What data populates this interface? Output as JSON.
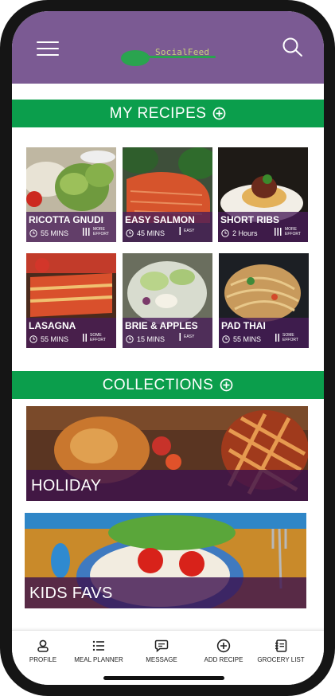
{
  "app": {
    "logo_text": "SocialFeed"
  },
  "sections": {
    "recipes_title": "MY RECIPES",
    "collections_title": "COLLECTIONS"
  },
  "recipes": [
    {
      "title": "RICOTTA GNUDI",
      "time": "55 MINS",
      "effort": "MORE EFFORT"
    },
    {
      "title": "EASY SALMON",
      "time": "45 MINS",
      "effort": "EASY"
    },
    {
      "title": "SHORT RIBS",
      "time": "2 Hours",
      "effort": "MORE EFFORT"
    },
    {
      "title": "LASAGNA",
      "time": "55 MINS",
      "effort": "SOME EFFORT"
    },
    {
      "title": "BRIE & APPLES",
      "time": "15 MINS",
      "effort": "EASY"
    },
    {
      "title": "PAD THAI",
      "time": "55 MINS",
      "effort": "SOME EFFORT"
    }
  ],
  "collections": [
    {
      "label": "HOLIDAY"
    },
    {
      "label": "KIDS FAVS"
    }
  ],
  "nav": [
    {
      "label": "PROFILE",
      "icon": "profile-icon"
    },
    {
      "label": "MEAL PLANNER",
      "icon": "list-icon"
    },
    {
      "label": "MESSAGE",
      "icon": "message-icon"
    },
    {
      "label": "ADD RECIPE",
      "icon": "add-circle-icon"
    },
    {
      "label": "GROCERY LIST",
      "icon": "notebook-icon"
    }
  ],
  "colors": {
    "header": "#7b5a93",
    "section_bar": "#0b9e4c",
    "card_band": "#481c58",
    "logo": "#2aa44f"
  }
}
